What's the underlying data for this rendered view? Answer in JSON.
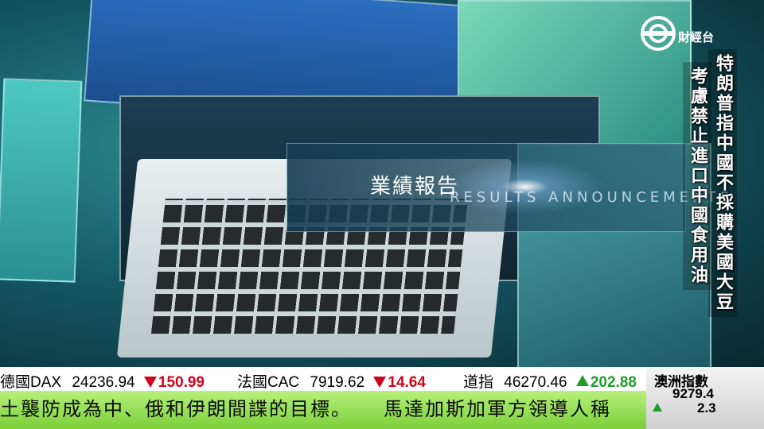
{
  "banner": {
    "title": "業績報告",
    "subtitle": "RESULTS ANNOUNCEMENTS"
  },
  "channel": {
    "logo": "tvb-logo",
    "name": "財經台"
  },
  "headline": {
    "line1": "特朗普指中國不採購美國大豆",
    "line2": "考慮禁止進口中國食用油"
  },
  "ticker": [
    {
      "name": "德國DAX",
      "value": "24236.94",
      "direction": "down",
      "change": "150.99"
    },
    {
      "name": "法國CAC",
      "value": "7919.62",
      "direction": "down",
      "change": "14.64"
    },
    {
      "name": "道指",
      "value": "46270.46",
      "direction": "up",
      "change": "202.88"
    }
  ],
  "crawl": {
    "text": "土襲防成為中、俄和伊朗間諜的目標。　　馬達加斯加軍方領導人稱"
  },
  "asia_index": {
    "title": "澳洲指數",
    "value": "9279.4",
    "direction": "up",
    "change": "2.3"
  },
  "colors": {
    "down": "#d0021b",
    "up": "#1f9e2a",
    "crawl_bg": "#9be05a"
  }
}
